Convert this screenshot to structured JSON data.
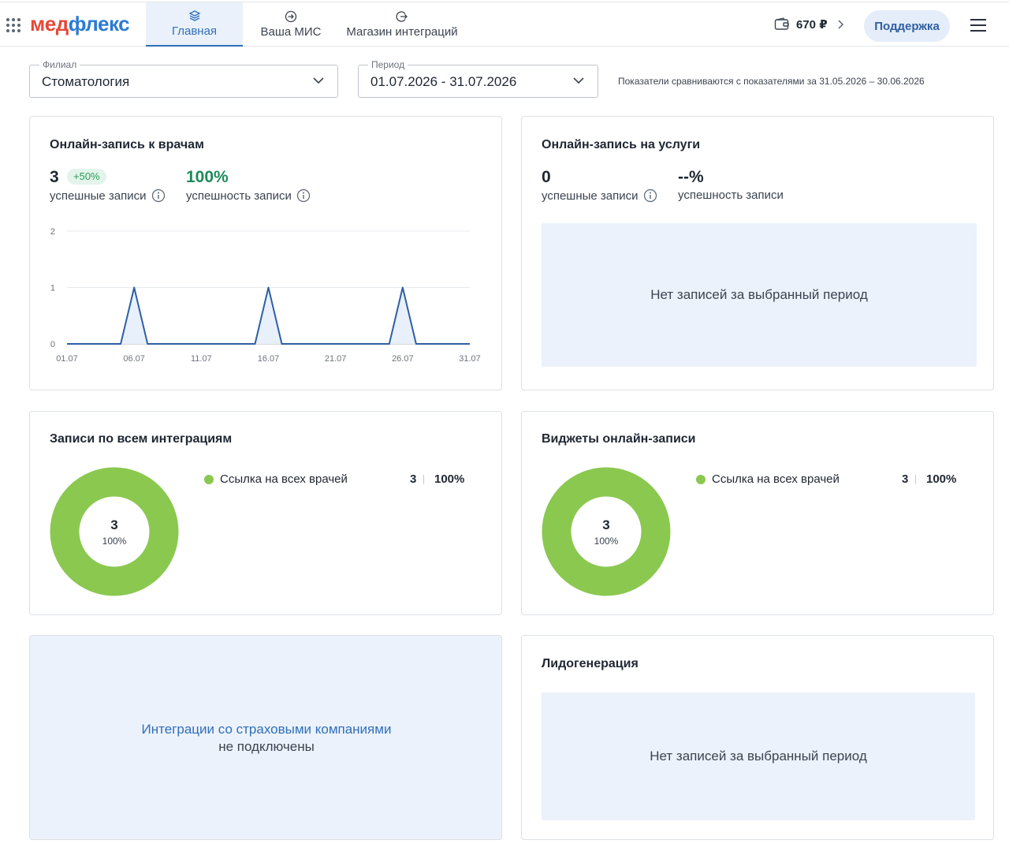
{
  "header": {
    "logo_part1": "мед",
    "logo_part2": "флекс",
    "nav": [
      {
        "label": "Главная",
        "icon": "layers-icon",
        "active": true
      },
      {
        "label": "Ваша МИС",
        "icon": "login-icon",
        "active": false
      },
      {
        "label": "Магазин интеграций",
        "icon": "logout-icon",
        "active": false
      }
    ],
    "balance": "670 ₽",
    "support_label": "Поддержка"
  },
  "filters": {
    "branch_label": "Филиал",
    "branch_value": "Стоматология",
    "period_label": "Период",
    "period_value": "01.07.2026 - 31.07.2026",
    "compare_note": "Показатели сравниваются с показателями за 31.05.2026 – 30.06.2026"
  },
  "doctors_card": {
    "title": "Онлайн-запись к врачам",
    "count": "3",
    "count_delta": "+50%",
    "count_label": "успешные записи",
    "rate": "100%",
    "rate_label": "успешность записи"
  },
  "services_card": {
    "title": "Онлайн-запись на услуги",
    "count": "0",
    "count_label": "успешные записи",
    "rate": "--%",
    "rate_label": "успешность записи",
    "empty_text": "Нет записей за выбранный период"
  },
  "integrations_card": {
    "title": "Записи по всем интеграциям",
    "legend": [
      {
        "label": "Ссылка на всех врачей",
        "count": "3",
        "pct": "100%"
      }
    ],
    "center_value": "3",
    "center_pct": "100%"
  },
  "widgets_card": {
    "title": "Виджеты онлайн-записи",
    "legend": [
      {
        "label": "Ссылка на всех врачей",
        "count": "3",
        "pct": "100%"
      }
    ],
    "center_value": "3",
    "center_pct": "100%"
  },
  "insurance_card": {
    "line1": "Интеграции со страховыми компаниями",
    "line2": "не подключены"
  },
  "leadgen_card": {
    "title": "Лидогенерация",
    "empty_text": "Нет записей за выбранный период"
  },
  "colors": {
    "accent": "#2f6fb8",
    "line": "#2f5fa3",
    "donut": "#8bc850",
    "positive": "#1d8a5a"
  },
  "chart_data": {
    "type": "line",
    "x": [
      "01.07",
      "02.07",
      "03.07",
      "04.07",
      "05.07",
      "06.07",
      "07.07",
      "08.07",
      "09.07",
      "10.07",
      "11.07",
      "12.07",
      "13.07",
      "14.07",
      "15.07",
      "16.07",
      "17.07",
      "18.07",
      "19.07",
      "20.07",
      "21.07",
      "22.07",
      "23.07",
      "24.07",
      "25.07",
      "26.07",
      "27.07",
      "28.07",
      "29.07",
      "30.07",
      "31.07"
    ],
    "series": [
      {
        "values": [
          0,
          0,
          0,
          0,
          0,
          1,
          0,
          0,
          0,
          0,
          0,
          0,
          0,
          0,
          0,
          1,
          0,
          0,
          0,
          0,
          0,
          0,
          0,
          0,
          0,
          1,
          0,
          0,
          0,
          0,
          0
        ]
      }
    ],
    "x_tick_labels": [
      "01.07",
      "06.07",
      "11.07",
      "16.07",
      "21.07",
      "26.07",
      "31.07"
    ],
    "y_ticks": [
      "0",
      "1",
      "2"
    ],
    "ylim": [
      0,
      2
    ],
    "grid": true
  }
}
